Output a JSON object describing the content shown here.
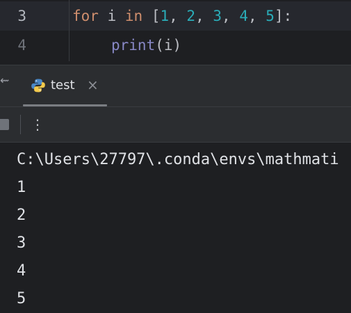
{
  "editor": {
    "lines": [
      {
        "number": "3",
        "tokens": {
          "for": "for",
          "var": " i ",
          "in": "in",
          "open": " [",
          "n1": "1",
          "c1": ", ",
          "n2": "2",
          "c2": ", ",
          "n3": "3",
          "c3": ", ",
          "n4": "4",
          "c4": ", ",
          "n5": "5",
          "close": "]:"
        }
      },
      {
        "number": "4",
        "tokens": {
          "fn": "print",
          "args": "(i)"
        }
      }
    ]
  },
  "run_tab": {
    "icon": "python-icon",
    "label": "test",
    "close_glyph": "×"
  },
  "toolbar": {
    "more_glyph": "⋮"
  },
  "console": {
    "lines": [
      "C:\\Users\\27797\\.conda\\envs\\mathmati",
      "1",
      "2",
      "3",
      "4",
      "5"
    ]
  },
  "colors": {
    "keyword": "#cf8e6d",
    "number": "#2aacb8",
    "builtin": "#8888c6",
    "text": "#bcbec4",
    "background": "#1e1f22",
    "panel": "#2b2d30"
  }
}
